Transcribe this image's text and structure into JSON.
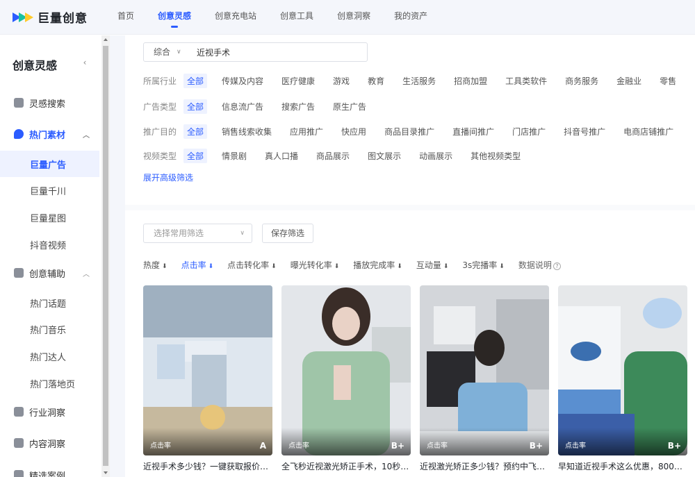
{
  "app": {
    "logo_text": "巨量创意"
  },
  "topnav": [
    "首页",
    "创意灵感",
    "创意充电站",
    "创意工具",
    "创意洞察",
    "我的资产"
  ],
  "sidebar": {
    "title": "创意灵感",
    "collapse": "‹",
    "items": [
      {
        "label": "灵感搜索",
        "type": "group"
      },
      {
        "label": "热门素材",
        "type": "group-open"
      },
      {
        "label": "巨量广告",
        "type": "sub-active"
      },
      {
        "label": "巨量千川",
        "type": "sub"
      },
      {
        "label": "巨量星图",
        "type": "sub"
      },
      {
        "label": "抖音视频",
        "type": "sub"
      },
      {
        "label": "创意辅助",
        "type": "group-open"
      },
      {
        "label": "热门话题",
        "type": "sub"
      },
      {
        "label": "热门音乐",
        "type": "sub"
      },
      {
        "label": "热门达人",
        "type": "sub"
      },
      {
        "label": "热门落地页",
        "type": "sub"
      },
      {
        "label": "行业洞察",
        "type": "group"
      },
      {
        "label": "内容洞察",
        "type": "group"
      },
      {
        "label": "精选案例",
        "type": "group"
      }
    ]
  },
  "search": {
    "type": "综合",
    "value": "近视手术"
  },
  "filters": {
    "industry": {
      "label": "所属行业",
      "options": [
        "全部",
        "传媒及内容",
        "医疗健康",
        "游戏",
        "教育",
        "生活服务",
        "招商加盟",
        "工具类软件",
        "商务服务",
        "金融业",
        "零售"
      ]
    },
    "ad_type": {
      "label": "广告类型",
      "options": [
        "全部",
        "信息流广告",
        "搜索广告",
        "原生广告"
      ]
    },
    "goal": {
      "label": "推广目的",
      "options": [
        "全部",
        "销售线索收集",
        "应用推广",
        "快应用",
        "商品目录推广",
        "直播间推广",
        "门店推广",
        "抖音号推广",
        "电商店铺推广"
      ]
    },
    "video_type": {
      "label": "视频类型",
      "options": [
        "全部",
        "情景剧",
        "真人口播",
        "商品展示",
        "图文展示",
        "动画展示",
        "其他视频类型"
      ]
    },
    "advanced": "展开高级筛选"
  },
  "preset": {
    "placeholder": "选择常用筛选",
    "save": "保存筛选"
  },
  "sort": [
    "热度",
    "点击率",
    "点击转化率",
    "曝光转化率",
    "播放完成率",
    "互动量",
    "3s完播率"
  ],
  "help": "数据说明",
  "cards": [
    {
      "metric": "点击率",
      "grade": "A",
      "title": "近视手术多少钱？一键获取报价…"
    },
    {
      "metric": "点击率",
      "grade": "B+",
      "title": "全飞秒近视激光矫正手术，10秒…"
    },
    {
      "metric": "点击率",
      "grade": "B+",
      "title": "近视激光矫正多少钱？预约中飞…"
    },
    {
      "metric": "点击率",
      "grade": "B+",
      "title": "早知道近视手术这么优惠，800…"
    }
  ],
  "colors": {
    "accent": "#2b5cff",
    "topbar_bg": "#f4f6fb"
  }
}
